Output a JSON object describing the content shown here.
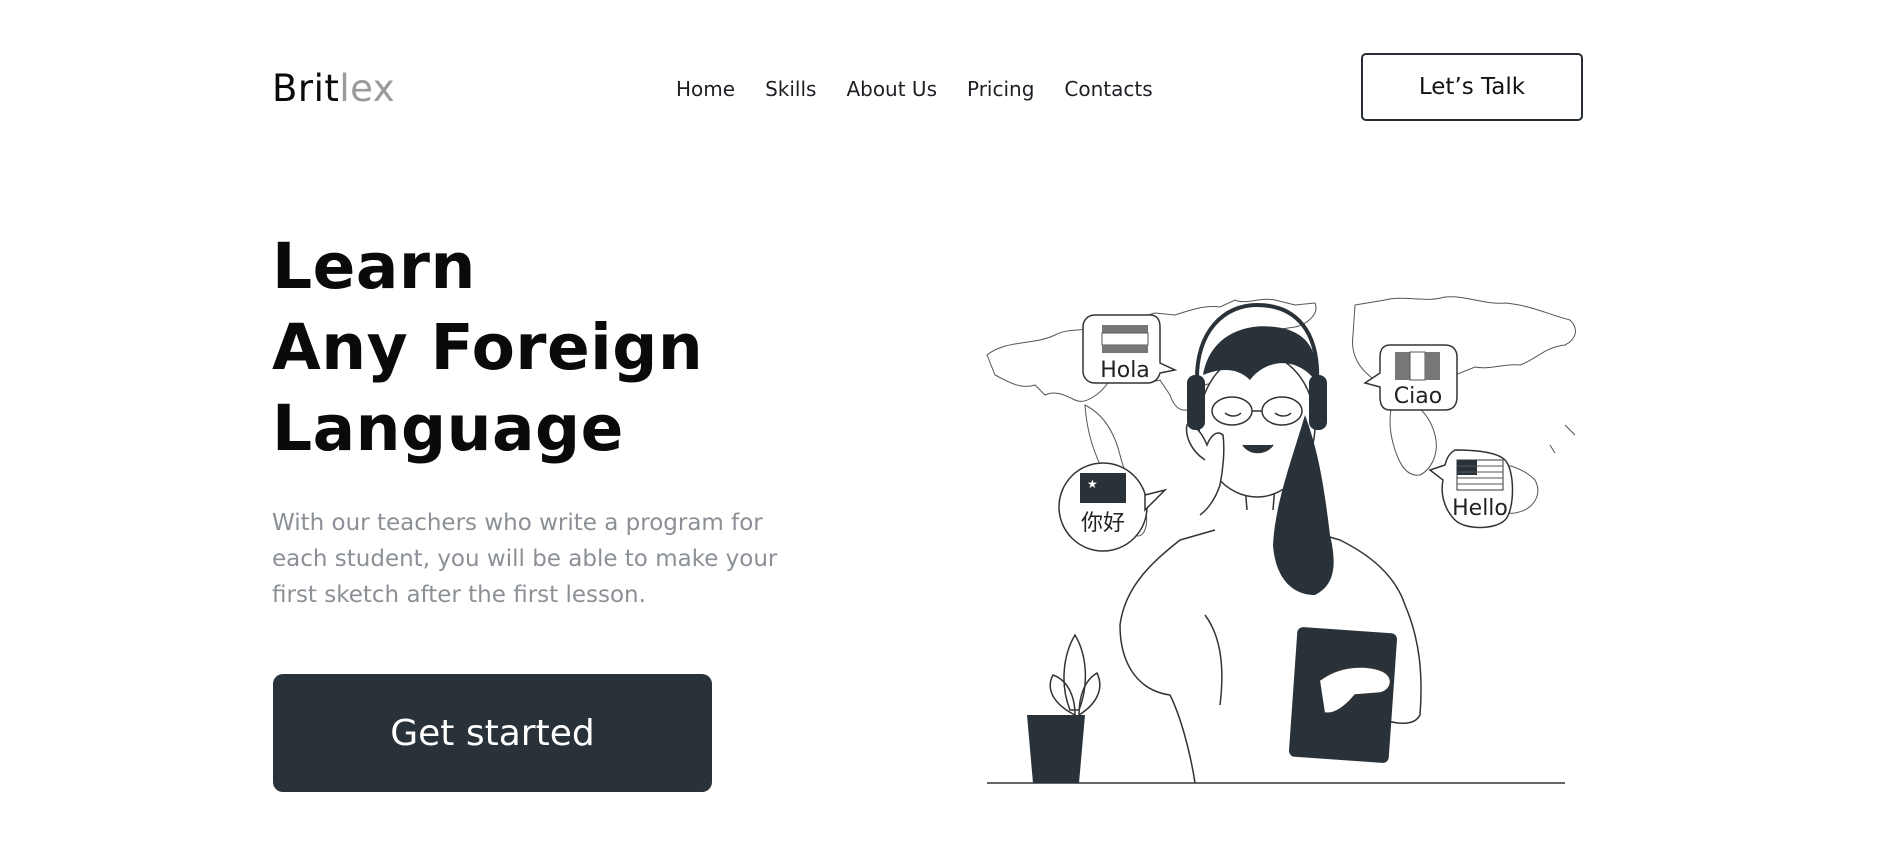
{
  "header": {
    "logo": {
      "part1": "Brit",
      "part2": "lex"
    },
    "nav": [
      "Home",
      "Skills",
      "About Us",
      "Pricing",
      "Contacts"
    ],
    "cta_label": "Let’s Talk"
  },
  "hero": {
    "title_lines": [
      "Learn",
      "Any Foreign",
      "Language"
    ],
    "description_lines": [
      "With our teachers who write a program for",
      "each student, you will be able to make your",
      "first sketch after the first lesson."
    ],
    "button_label": "Get started"
  },
  "illustration": {
    "greetings": {
      "spanish": "Hola",
      "italian": "Ciao",
      "chinese": "你好",
      "english": "Hello"
    },
    "colors": {
      "dark": "#2a3239",
      "line": "#333333",
      "muted": "#9a9a9a"
    }
  }
}
